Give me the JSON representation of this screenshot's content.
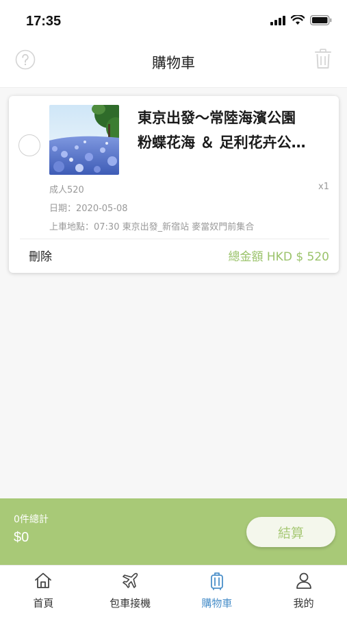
{
  "status_bar": {
    "time": "17:35"
  },
  "nav": {
    "title": "購物車"
  },
  "cart_item": {
    "title_line1": "東京出發～常陸海濱公園",
    "title_line2": "粉蝶花海 ＆ 足利花卉公…",
    "ticket": "成人520",
    "quantity": "x1",
    "date": "日期：2020-05-08",
    "pickup": "上車地點：07:30 東京出發_新宿站 麥當奴門前集合",
    "delete_label": "刪除",
    "total_label": "總金額 HKD $ 520"
  },
  "checkout": {
    "count_label": "0件總計",
    "sum": "$0",
    "button_label": "結算"
  },
  "tabs": [
    {
      "label": "首頁",
      "icon": "home-icon"
    },
    {
      "label": "包車接機",
      "icon": "plane-icon"
    },
    {
      "label": "購物車",
      "icon": "luggage-icon",
      "active": true
    },
    {
      "label": "我的",
      "icon": "person-icon"
    }
  ],
  "colors": {
    "accent_green": "#a8c977",
    "price_green": "#9bc36b",
    "active_tab_blue": "#4a8fc9"
  }
}
